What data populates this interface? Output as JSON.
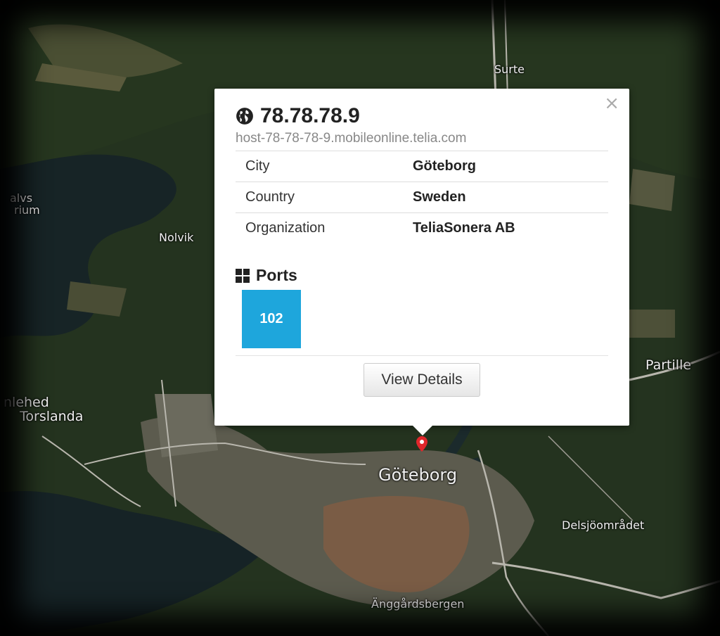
{
  "map": {
    "places": [
      {
        "id": "surte",
        "name": "Surte"
      },
      {
        "id": "alvs",
        "name": "alvs"
      },
      {
        "id": "rium",
        "name": "rium"
      },
      {
        "id": "nolvik",
        "name": "Nolvik"
      },
      {
        "id": "partille",
        "name": "Partille"
      },
      {
        "id": "lehed",
        "name": "nlehed"
      },
      {
        "id": "torslanda",
        "name": "Torslanda"
      },
      {
        "id": "goteborg",
        "name": "Göteborg"
      },
      {
        "id": "delsjo",
        "name": "Delsjöområdet"
      },
      {
        "id": "anggard",
        "name": "Änggårdsbergen"
      }
    ],
    "colors": {
      "forest": "#1f2e1c",
      "water": "#172426",
      "urban": "#6c6b60",
      "road": "#b8b6ad",
      "marker": "#e0262b"
    }
  },
  "popup": {
    "close_label": "×",
    "ip": "78.78.78.9",
    "hostname": "host-78-78-78-9.mobileonline.telia.com",
    "globe_icon": "globe-icon",
    "rows": [
      {
        "label": "City",
        "value": "Göteborg"
      },
      {
        "label": "Country",
        "value": "Sweden"
      },
      {
        "label": "Organization",
        "value": "TeliaSonera AB"
      }
    ],
    "ports_icon": "grid-icon",
    "ports_title": "Ports",
    "ports": [
      "102"
    ],
    "port_color": "#1ea6dc",
    "view_details_label": "View Details"
  }
}
